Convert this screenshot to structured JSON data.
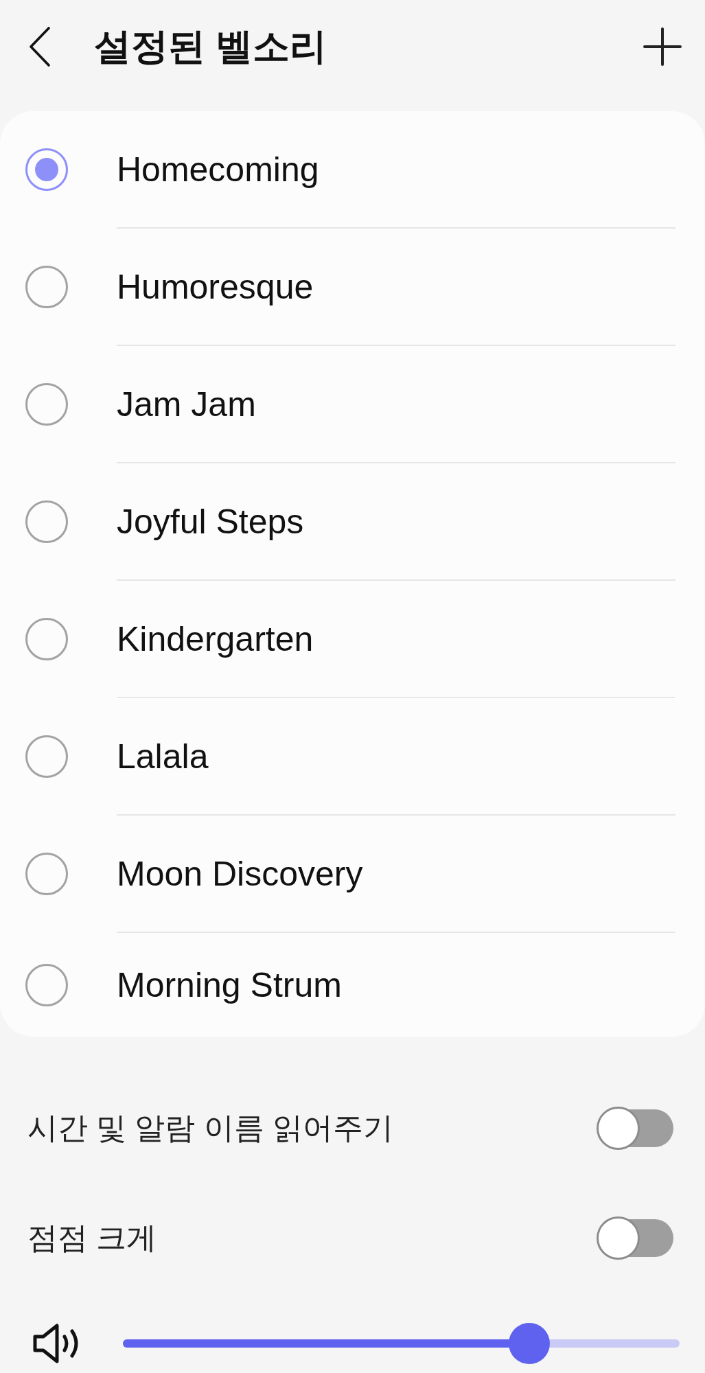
{
  "header": {
    "title": "설정된 벨소리"
  },
  "ringtones": [
    {
      "name": "Homecoming",
      "selected": true
    },
    {
      "name": "Humoresque",
      "selected": false
    },
    {
      "name": "Jam Jam",
      "selected": false
    },
    {
      "name": "Joyful Steps",
      "selected": false
    },
    {
      "name": "Kindergarten",
      "selected": false
    },
    {
      "name": "Lalala",
      "selected": false
    },
    {
      "name": "Moon Discovery",
      "selected": false
    },
    {
      "name": "Morning Strum",
      "selected": false
    }
  ],
  "settings": [
    {
      "label": "시간 및 알람 이름 읽어주기",
      "on": false
    },
    {
      "label": "점점 크게",
      "on": false
    }
  ],
  "volume": {
    "level": 0.73
  }
}
